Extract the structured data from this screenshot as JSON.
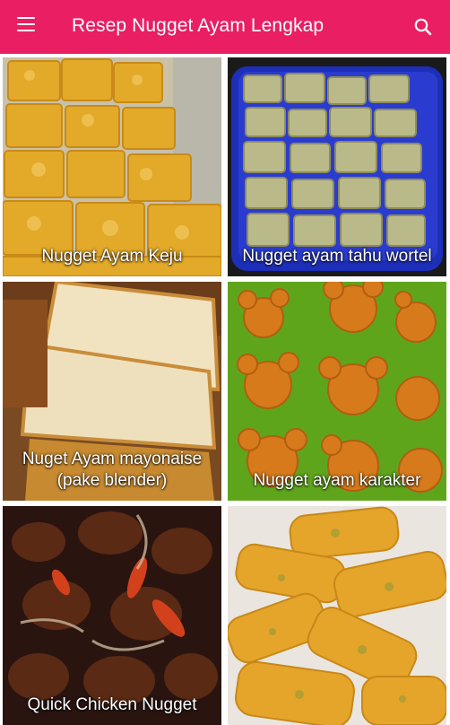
{
  "app_bar": {
    "title": "Resep Nugget Ayam Lengkap",
    "menu_icon": "hamburger-menu-icon",
    "search_icon": "search-icon",
    "color": "#e91e63"
  },
  "recipes": [
    {
      "title": "Nugget Ayam Keju"
    },
    {
      "title": "Nugget ayam tahu wortel"
    },
    {
      "title": "Nuget Ayam mayonaise (pake blender)"
    },
    {
      "title": "Nugget ayam karakter"
    },
    {
      "title": "Quick Chicken Nugget"
    },
    {
      "title": ""
    }
  ]
}
